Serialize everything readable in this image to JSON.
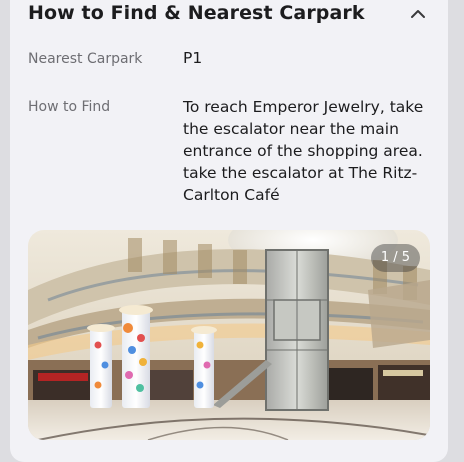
{
  "section": {
    "title": "How to Find & Nearest Carpark",
    "collapse_icon": "chevron-up-icon"
  },
  "nearest_carpark": {
    "label": "Nearest Carpark",
    "value": "P1"
  },
  "how_to_find": {
    "label": "How to Find",
    "value": "To reach Emperor Jewelry, take the escalator near the main entrance of the shopping area. take the escalator at The Ritz-Carlton Café"
  },
  "gallery": {
    "counter": "1 / 5",
    "image_subject": "shopping mall atrium with glass elevator and decorated columns"
  },
  "colors": {
    "card_background": "#f2f2f6",
    "page_background": "#dddde1",
    "title_text": "#1c1c1e",
    "label_text": "#6e6e73"
  }
}
